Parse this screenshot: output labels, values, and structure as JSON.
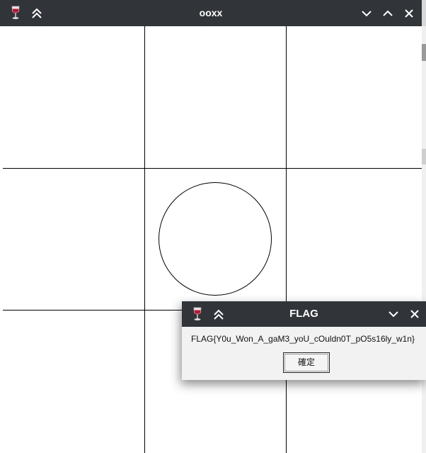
{
  "main_window": {
    "title": "ooxx",
    "icon": "wine-glass-icon",
    "board": {
      "cells": [
        "",
        "",
        "",
        "",
        "O",
        "",
        "",
        "",
        ""
      ]
    }
  },
  "dialog": {
    "title": "FLAG",
    "icon": "wine-glass-icon",
    "message": "FLAG{Y0u_Won_A_gaM3_yoU_cOuldn0T_pO5s16ly_w1n}",
    "ok_label": "確定"
  },
  "colors": {
    "titlebar": "#313438",
    "board_background": "#ffffff",
    "dialog_background": "#f2f2f2",
    "grid_line": "#000000"
  }
}
